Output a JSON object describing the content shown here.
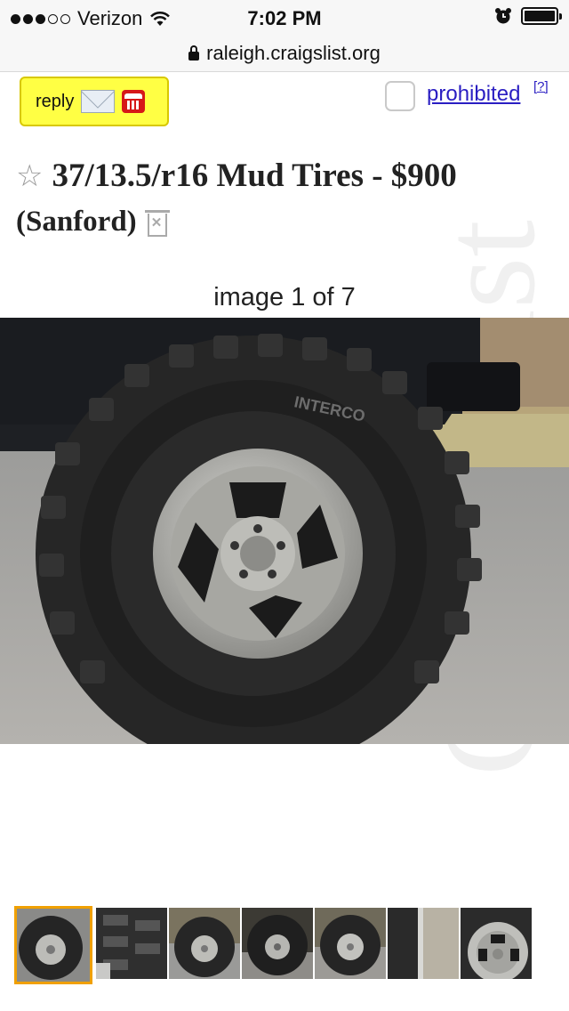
{
  "status_bar": {
    "carrier": "Verizon",
    "time": "7:02 PM",
    "signal_bars_filled": 3,
    "signal_bars_total": 5
  },
  "browser": {
    "url": "raleigh.craigslist.org"
  },
  "watermark": "CraigsList",
  "post": {
    "reply_label": "reply",
    "prohibited_label": "prohibited",
    "help_label": "[?]",
    "title": "37/13.5/r16 Mud Tires - $900",
    "location": "(Sanford)",
    "image_caption": "image 1 of 7",
    "tire_brand": "INTERCO"
  },
  "colors": {
    "reply_bg": "#ffff44",
    "link": "#2a1ec2",
    "thumb_selected_border": "#f0a000"
  },
  "thumbnails": {
    "count": 7,
    "selected_index": 0
  }
}
